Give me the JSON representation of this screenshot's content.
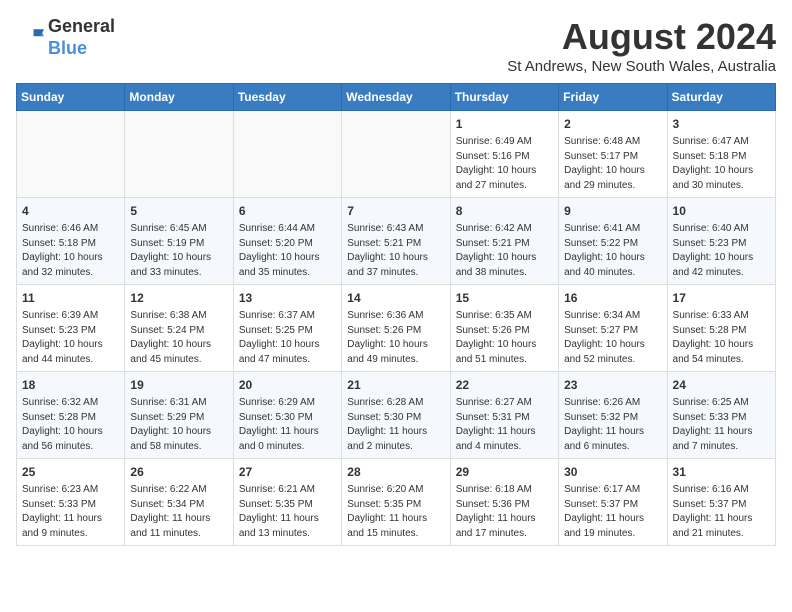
{
  "header": {
    "logo_general": "General",
    "logo_blue": "Blue",
    "month_year": "August 2024",
    "location": "St Andrews, New South Wales, Australia"
  },
  "days_of_week": [
    "Sunday",
    "Monday",
    "Tuesday",
    "Wednesday",
    "Thursday",
    "Friday",
    "Saturday"
  ],
  "weeks": [
    [
      {
        "day": "",
        "info": ""
      },
      {
        "day": "",
        "info": ""
      },
      {
        "day": "",
        "info": ""
      },
      {
        "day": "",
        "info": ""
      },
      {
        "day": "1",
        "info": "Sunrise: 6:49 AM\nSunset: 5:16 PM\nDaylight: 10 hours\nand 27 minutes."
      },
      {
        "day": "2",
        "info": "Sunrise: 6:48 AM\nSunset: 5:17 PM\nDaylight: 10 hours\nand 29 minutes."
      },
      {
        "day": "3",
        "info": "Sunrise: 6:47 AM\nSunset: 5:18 PM\nDaylight: 10 hours\nand 30 minutes."
      }
    ],
    [
      {
        "day": "4",
        "info": "Sunrise: 6:46 AM\nSunset: 5:18 PM\nDaylight: 10 hours\nand 32 minutes."
      },
      {
        "day": "5",
        "info": "Sunrise: 6:45 AM\nSunset: 5:19 PM\nDaylight: 10 hours\nand 33 minutes."
      },
      {
        "day": "6",
        "info": "Sunrise: 6:44 AM\nSunset: 5:20 PM\nDaylight: 10 hours\nand 35 minutes."
      },
      {
        "day": "7",
        "info": "Sunrise: 6:43 AM\nSunset: 5:21 PM\nDaylight: 10 hours\nand 37 minutes."
      },
      {
        "day": "8",
        "info": "Sunrise: 6:42 AM\nSunset: 5:21 PM\nDaylight: 10 hours\nand 38 minutes."
      },
      {
        "day": "9",
        "info": "Sunrise: 6:41 AM\nSunset: 5:22 PM\nDaylight: 10 hours\nand 40 minutes."
      },
      {
        "day": "10",
        "info": "Sunrise: 6:40 AM\nSunset: 5:23 PM\nDaylight: 10 hours\nand 42 minutes."
      }
    ],
    [
      {
        "day": "11",
        "info": "Sunrise: 6:39 AM\nSunset: 5:23 PM\nDaylight: 10 hours\nand 44 minutes."
      },
      {
        "day": "12",
        "info": "Sunrise: 6:38 AM\nSunset: 5:24 PM\nDaylight: 10 hours\nand 45 minutes."
      },
      {
        "day": "13",
        "info": "Sunrise: 6:37 AM\nSunset: 5:25 PM\nDaylight: 10 hours\nand 47 minutes."
      },
      {
        "day": "14",
        "info": "Sunrise: 6:36 AM\nSunset: 5:26 PM\nDaylight: 10 hours\nand 49 minutes."
      },
      {
        "day": "15",
        "info": "Sunrise: 6:35 AM\nSunset: 5:26 PM\nDaylight: 10 hours\nand 51 minutes."
      },
      {
        "day": "16",
        "info": "Sunrise: 6:34 AM\nSunset: 5:27 PM\nDaylight: 10 hours\nand 52 minutes."
      },
      {
        "day": "17",
        "info": "Sunrise: 6:33 AM\nSunset: 5:28 PM\nDaylight: 10 hours\nand 54 minutes."
      }
    ],
    [
      {
        "day": "18",
        "info": "Sunrise: 6:32 AM\nSunset: 5:28 PM\nDaylight: 10 hours\nand 56 minutes."
      },
      {
        "day": "19",
        "info": "Sunrise: 6:31 AM\nSunset: 5:29 PM\nDaylight: 10 hours\nand 58 minutes."
      },
      {
        "day": "20",
        "info": "Sunrise: 6:29 AM\nSunset: 5:30 PM\nDaylight: 11 hours\nand 0 minutes."
      },
      {
        "day": "21",
        "info": "Sunrise: 6:28 AM\nSunset: 5:30 PM\nDaylight: 11 hours\nand 2 minutes."
      },
      {
        "day": "22",
        "info": "Sunrise: 6:27 AM\nSunset: 5:31 PM\nDaylight: 11 hours\nand 4 minutes."
      },
      {
        "day": "23",
        "info": "Sunrise: 6:26 AM\nSunset: 5:32 PM\nDaylight: 11 hours\nand 6 minutes."
      },
      {
        "day": "24",
        "info": "Sunrise: 6:25 AM\nSunset: 5:33 PM\nDaylight: 11 hours\nand 7 minutes."
      }
    ],
    [
      {
        "day": "25",
        "info": "Sunrise: 6:23 AM\nSunset: 5:33 PM\nDaylight: 11 hours\nand 9 minutes."
      },
      {
        "day": "26",
        "info": "Sunrise: 6:22 AM\nSunset: 5:34 PM\nDaylight: 11 hours\nand 11 minutes."
      },
      {
        "day": "27",
        "info": "Sunrise: 6:21 AM\nSunset: 5:35 PM\nDaylight: 11 hours\nand 13 minutes."
      },
      {
        "day": "28",
        "info": "Sunrise: 6:20 AM\nSunset: 5:35 PM\nDaylight: 11 hours\nand 15 minutes."
      },
      {
        "day": "29",
        "info": "Sunrise: 6:18 AM\nSunset: 5:36 PM\nDaylight: 11 hours\nand 17 minutes."
      },
      {
        "day": "30",
        "info": "Sunrise: 6:17 AM\nSunset: 5:37 PM\nDaylight: 11 hours\nand 19 minutes."
      },
      {
        "day": "31",
        "info": "Sunrise: 6:16 AM\nSunset: 5:37 PM\nDaylight: 11 hours\nand 21 minutes."
      }
    ]
  ]
}
